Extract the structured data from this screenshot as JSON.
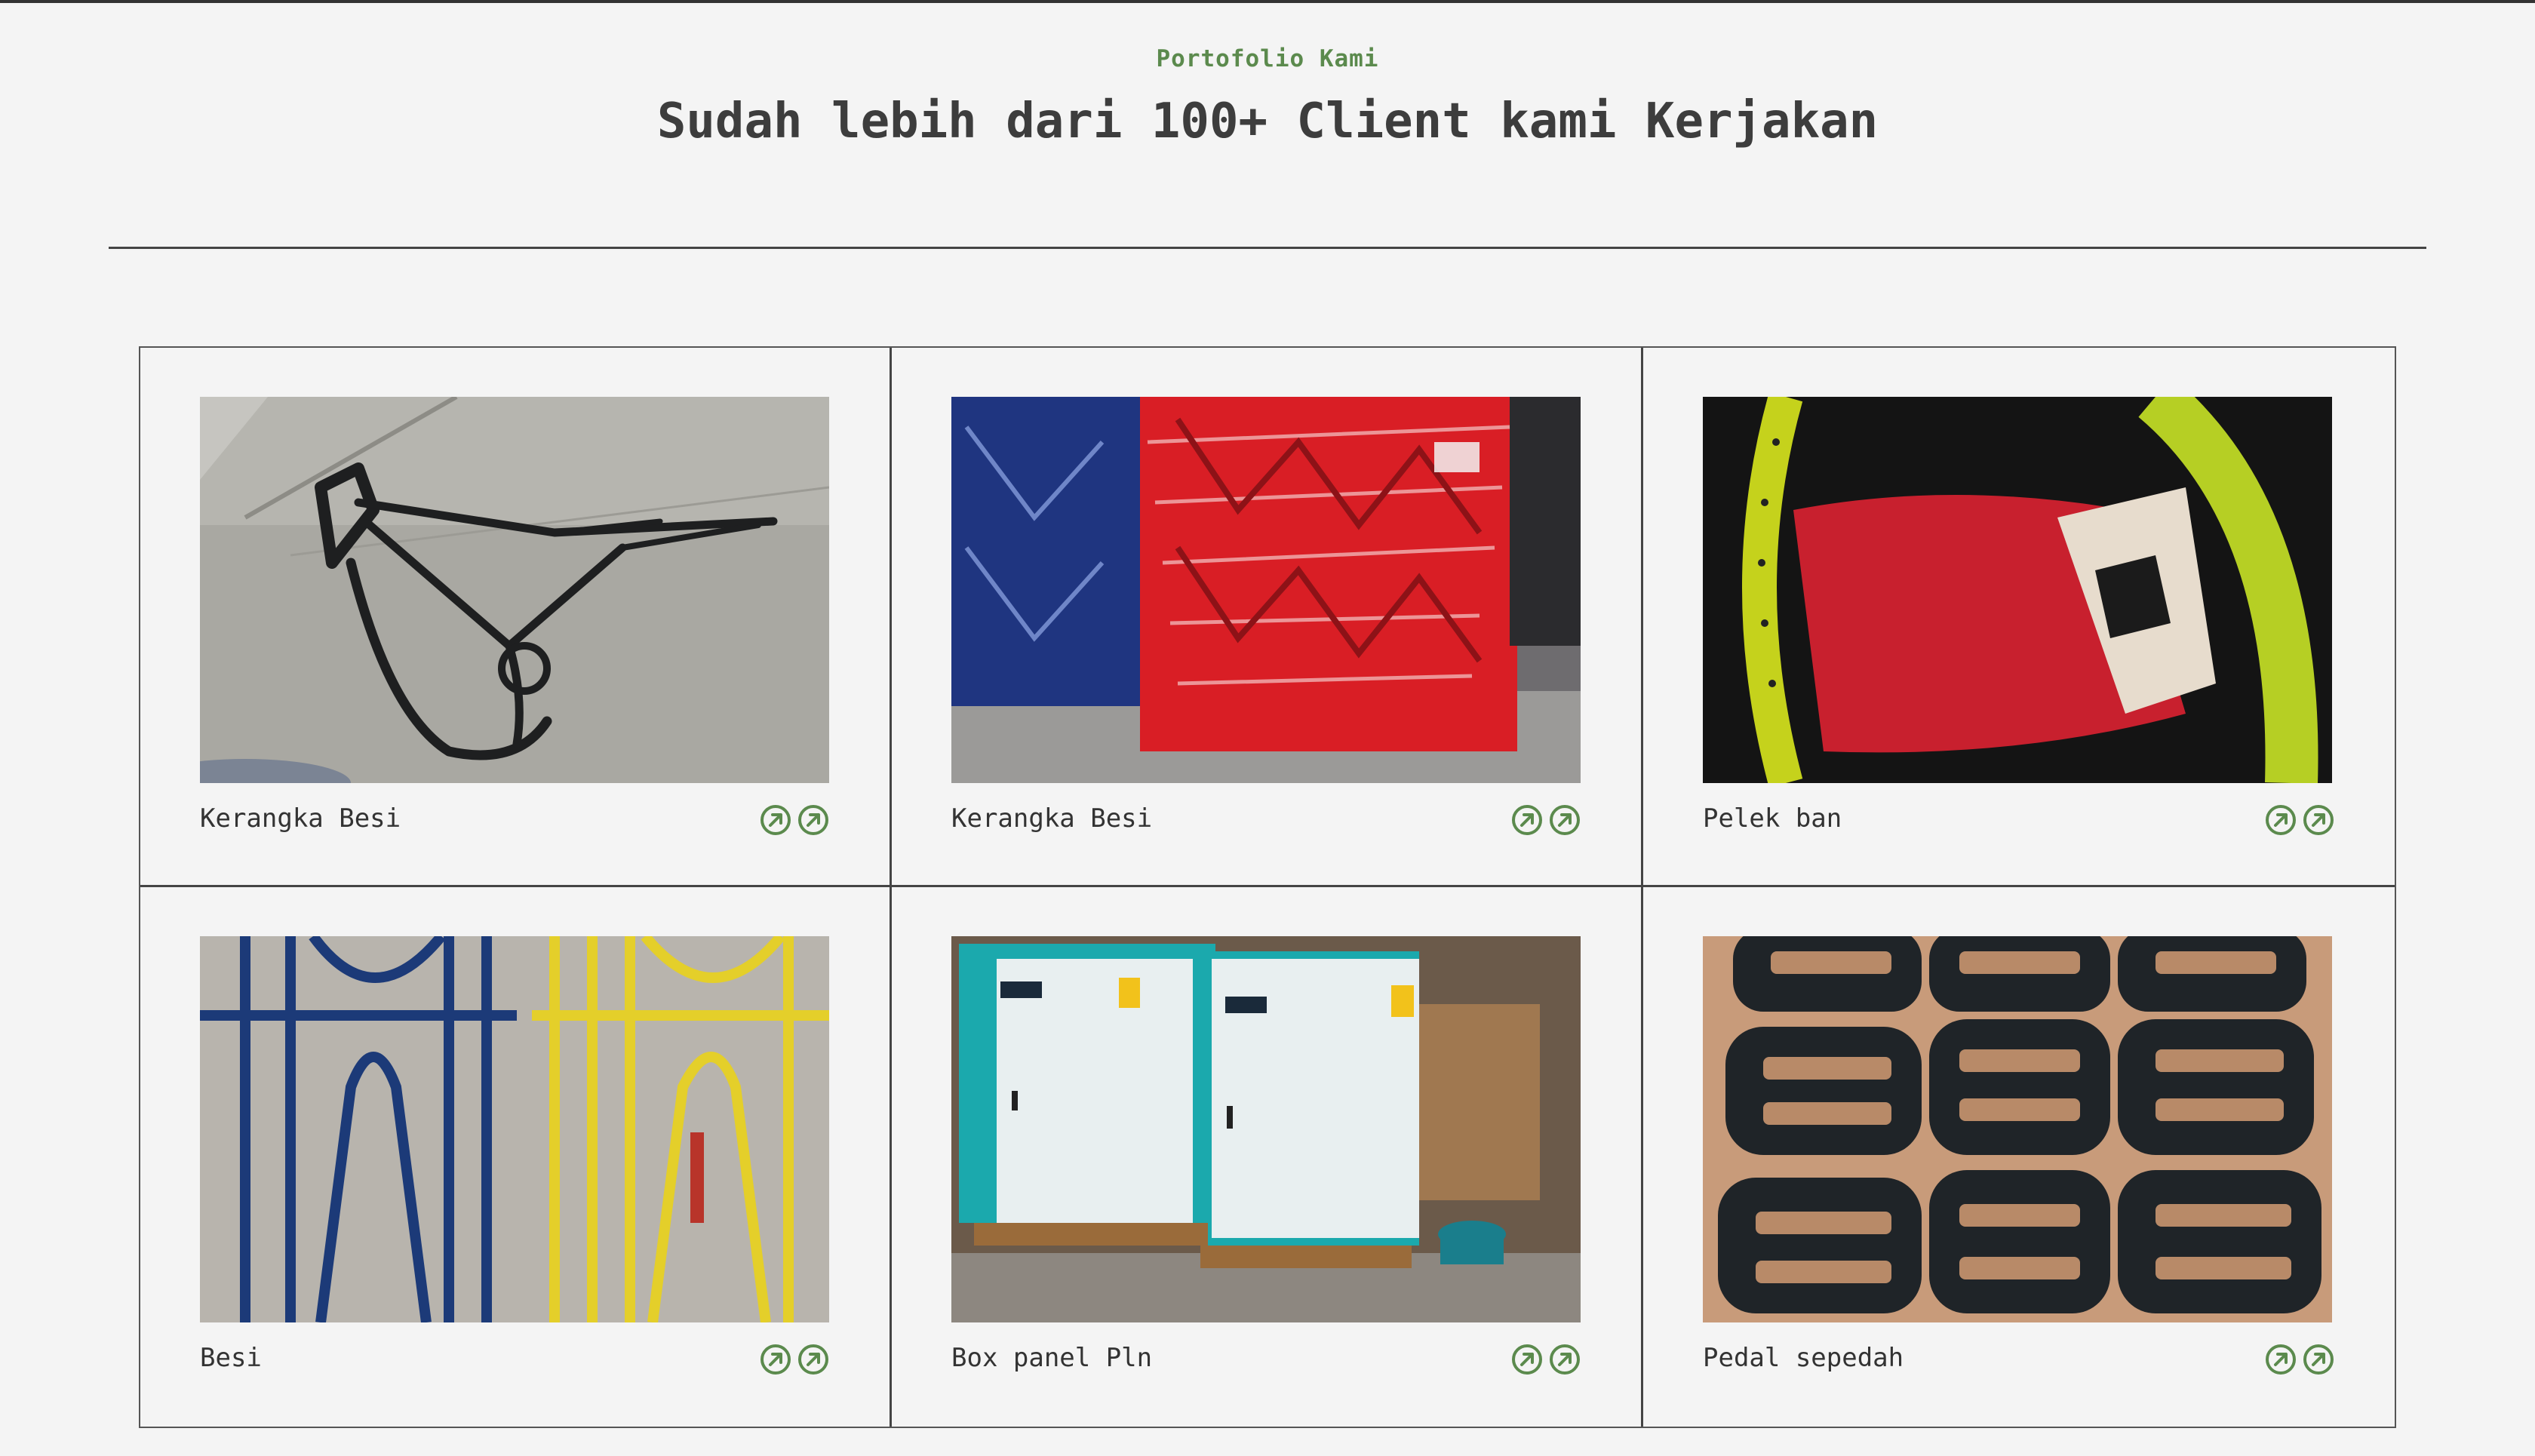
{
  "header": {
    "eyebrow": "Portofolio Kami",
    "title": "Sudah lebih dari 100+ Client kami Kerjakan"
  },
  "colors": {
    "accent_green": "#5b8a4d",
    "background": "#f4f4f4",
    "border": "#444444"
  },
  "portfolio": {
    "items": [
      {
        "caption": "Kerangka Besi",
        "image": "black-motorcycle-frame-photo"
      },
      {
        "caption": "Kerangka Besi",
        "image": "red-and-blue-frames-stack-photo"
      },
      {
        "caption": "Pelek ban",
        "image": "yellow-green-rims-photo"
      },
      {
        "caption": "Besi",
        "image": "blue-yellow-iron-grilles-photo"
      },
      {
        "caption": "Box panel Pln",
        "image": "pln-charging-panel-boxes-photo"
      },
      {
        "caption": "Pedal sepedah",
        "image": "black-bicycle-pedals-photo"
      }
    ],
    "icons": [
      "external-link-icon",
      "external-link-icon"
    ]
  }
}
